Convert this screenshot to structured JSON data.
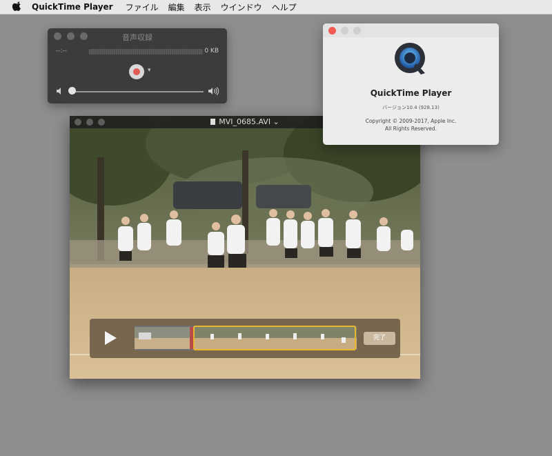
{
  "menubar": {
    "app_name": "QuickTime Player",
    "items": [
      "ファイル",
      "編集",
      "表示",
      "ウインドウ",
      "ヘルプ"
    ]
  },
  "recording_window": {
    "title": "音声収録",
    "time": "--:--",
    "size": "0 KB"
  },
  "about_window": {
    "app_name": "QuickTime Player",
    "version": "バージョン10.4 (928.13)",
    "copyright_line1": "Copyright © 2009-2017, Apple Inc.",
    "copyright_line2": "All Rights Reserved."
  },
  "movie_window": {
    "filename": "MVI_0685.AVI",
    "done_label": "完了"
  },
  "colors": {
    "close_button": "#f25a52",
    "record_dot": "#e05a55",
    "trim_selection": "#e8b830"
  },
  "icons": [
    "apple-icon",
    "record-icon",
    "speaker-low-icon",
    "speaker-high-icon",
    "quicktime-logo-icon",
    "document-icon",
    "play-icon"
  ]
}
